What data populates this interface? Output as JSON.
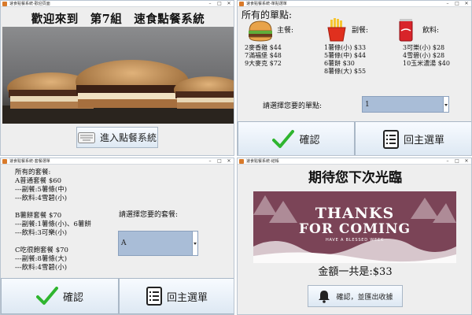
{
  "windows": {
    "welcome": {
      "title": "速食點餐系統-歡迎頁面",
      "heading": "歡迎來到　第7組　速食點餐系統",
      "enter_button": "進入點餐系統",
      "enter_icon": "keyboard-icon"
    },
    "single": {
      "title": "速食點餐系統-單點選單",
      "heading": "所有的單點:",
      "categories": [
        {
          "label": "主餐:",
          "icon": "burger-icon",
          "items": [
            "2麥香雞 $44",
            "7滿福堡 $48",
            "9大麥克 $72"
          ]
        },
        {
          "label": "副餐:",
          "icon": "fries-icon",
          "items": [
            "1薯條(小) $33",
            "5薯條(中) $44",
            "6薯餅 $30",
            "8薯條(大) $55"
          ]
        },
        {
          "label": "飲料:",
          "icon": "cola-icon",
          "items": [
            "3可樂(小) $28",
            "4雪碧(小) $28",
            "10玉米濃湯 $40"
          ]
        }
      ],
      "prompt": "請選擇您要的單點:",
      "selected": "1",
      "confirm_label": "確認",
      "back_label": "回主選單"
    },
    "combo": {
      "title": "速食點餐系統-套餐選單",
      "lines": [
        "所有的套餐:",
        "A普通套餐 $60",
        "---副餐:5薯條(中)",
        "---飲料:4雪碧(小)",
        "",
        "B薯餅套餐 $70",
        "---副餐:1薯條(小)、6薯餅",
        "---飲料:3可樂(小)",
        "",
        "C吃很飽套餐 $70",
        "---副餐:8薯條(大)",
        "---飲料:4雪碧(小)"
      ],
      "prompt": "請選擇您要的套餐:",
      "selected": "A",
      "confirm_label": "確認",
      "back_label": "回主選單"
    },
    "thanks": {
      "title": "速食點餐系統-結帳",
      "heading": "期待您下次光臨",
      "banner_line1": "THANKS",
      "banner_line2": "FOR COMING",
      "banner_line3": "HAVE A BLESSED WEEK",
      "total": "金額一共是:$33",
      "receipt_button": "確認，並匯出收據",
      "receipt_icon": "bell-icon"
    }
  },
  "colors": {
    "accent_blue": "#a9bdd7",
    "check_green": "#2fb52f",
    "banner_maroon": "#7b4457"
  }
}
